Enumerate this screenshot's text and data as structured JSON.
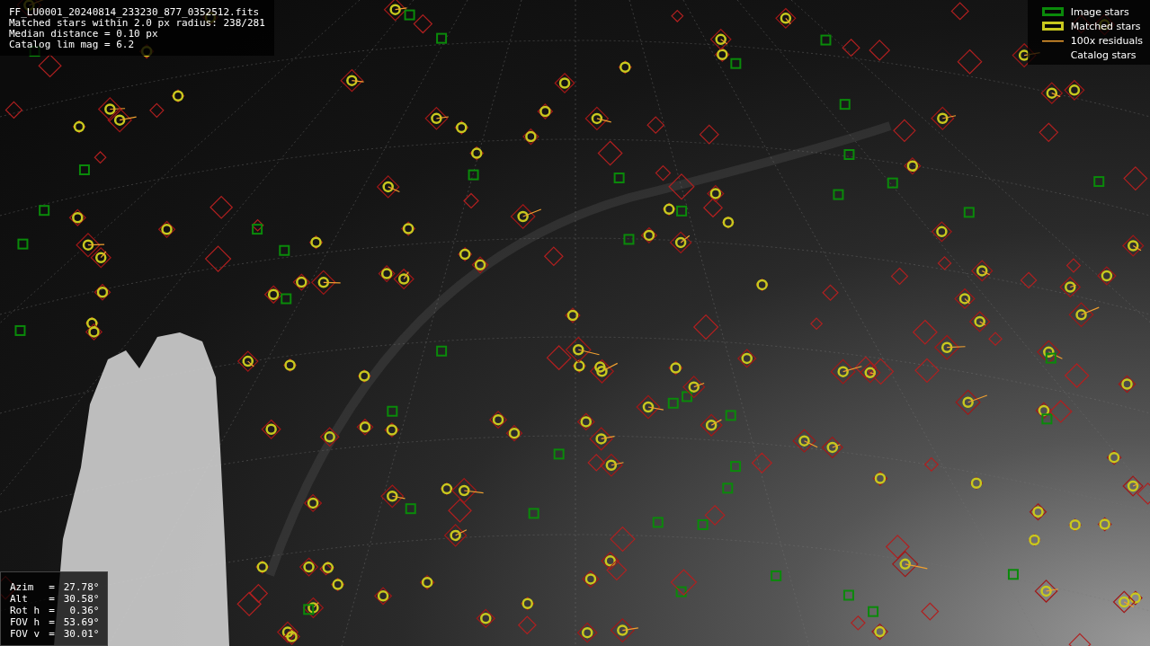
{
  "info": {
    "lines": [
      "FF_LU0001_20240814_233230_877_0352512.fits",
      "Matched stars within 2.0 px radius: 238/281",
      "Median distance = 0.10 px",
      "Catalog lim mag = 6.2"
    ]
  },
  "legend": [
    {
      "kind": "image",
      "label": "Image stars"
    },
    {
      "kind": "matched",
      "label": "Matched stars"
    },
    {
      "kind": "residual",
      "label": "100x residuals"
    },
    {
      "kind": "catalog",
      "label": "Catalog stars"
    }
  ],
  "pointing": [
    {
      "label": "Azim",
      "sign": "=",
      "value": "27.78°"
    },
    {
      "label": "Alt",
      "sign": "=",
      "value": "30.58°"
    },
    {
      "label": "Rot h",
      "sign": "=",
      "value": "0.36°"
    },
    {
      "label": "FOV h",
      "sign": "=",
      "value": "53.69°"
    },
    {
      "label": "FOV v",
      "sign": "=",
      "value": "30.01°"
    }
  ]
}
